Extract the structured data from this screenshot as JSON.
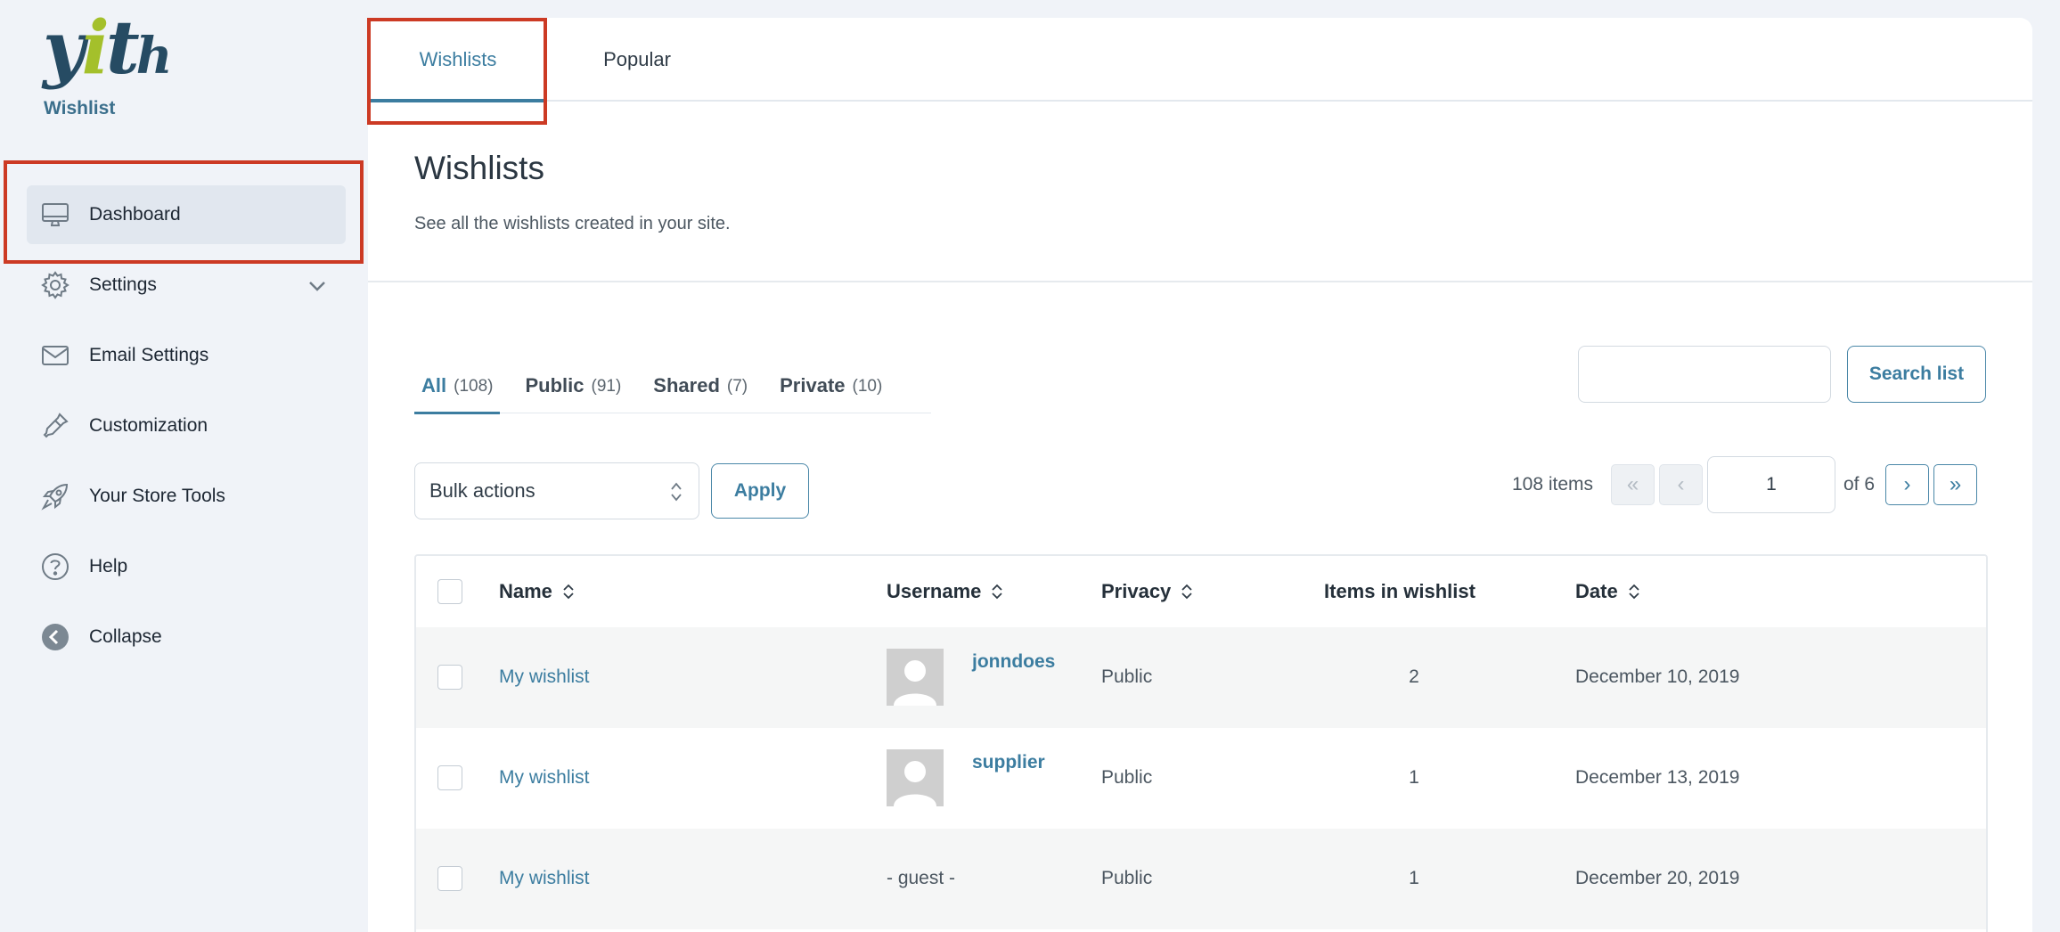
{
  "brand": {
    "logo_text": "yith",
    "label": "Wishlist"
  },
  "sidebar": {
    "items": [
      {
        "label": "Dashboard",
        "icon": "monitor-icon"
      },
      {
        "label": "Settings",
        "icon": "gear-icon"
      },
      {
        "label": "Email Settings",
        "icon": "envelope-icon"
      },
      {
        "label": "Customization",
        "icon": "pipette-icon"
      },
      {
        "label": "Your Store Tools",
        "icon": "rocket-icon"
      },
      {
        "label": "Help",
        "icon": "help-circle-icon"
      },
      {
        "label": "Collapse",
        "icon": "collapse-arrow-icon"
      }
    ]
  },
  "tabs": [
    {
      "label": "Wishlists"
    },
    {
      "label": "Popular"
    }
  ],
  "page": {
    "title": "Wishlists",
    "description": "See all the wishlists created in your site."
  },
  "filters": [
    {
      "label": "All",
      "count": "(108)"
    },
    {
      "label": "Public",
      "count": "(91)"
    },
    {
      "label": "Shared",
      "count": "(7)"
    },
    {
      "label": "Private",
      "count": "(10)"
    }
  ],
  "search": {
    "value": "",
    "button_label": "Search list"
  },
  "bulk": {
    "selected": "Bulk actions",
    "apply_label": "Apply"
  },
  "pagination": {
    "items_text": "108 items",
    "first": "«",
    "prev": "‹",
    "next": "›",
    "last": "»",
    "current_page": "1",
    "of_text": "of 6"
  },
  "table": {
    "columns": [
      "Name",
      "Username",
      "Privacy",
      "Items in wishlist",
      "Date"
    ],
    "rows": [
      {
        "name": "My wishlist",
        "username": "jonndoes",
        "has_avatar": true,
        "privacy": "Public",
        "items": "2",
        "date": "December 10, 2019"
      },
      {
        "name": "My wishlist",
        "username": "supplier",
        "has_avatar": true,
        "privacy": "Public",
        "items": "1",
        "date": "December 13, 2019"
      },
      {
        "name": "My wishlist",
        "username": "- guest -",
        "has_avatar": false,
        "privacy": "Public",
        "items": "1",
        "date": "December 20, 2019"
      }
    ]
  },
  "colors": {
    "accent": "#3c7da0",
    "highlight_box": "#cc3a24",
    "sidebar_bg": "#f0f3f8"
  }
}
